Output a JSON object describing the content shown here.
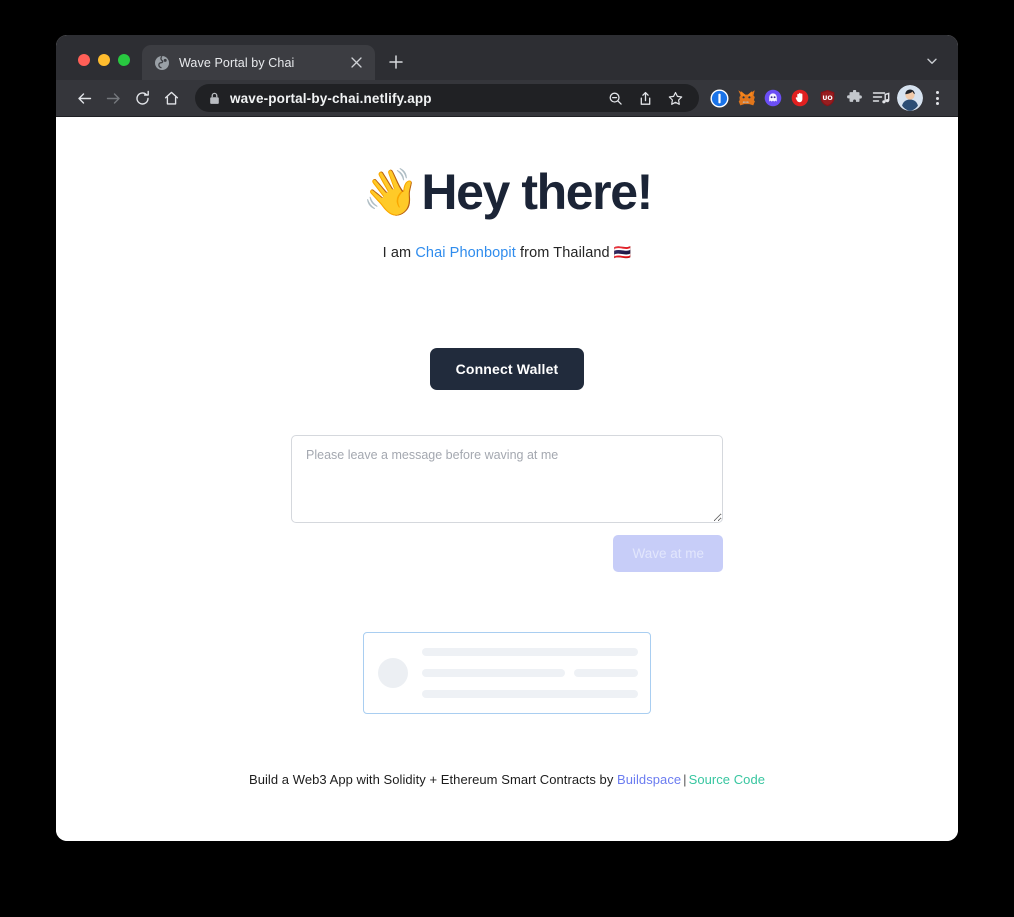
{
  "browser": {
    "tab": {
      "title": "Wave Portal by Chai",
      "favicon_icon": "globe-icon",
      "close_icon": "close-icon"
    },
    "new_tab_icon": "plus-icon",
    "tab_search_icon": "chevron-down-icon",
    "nav": {
      "back_icon": "back-arrow-icon",
      "forward_icon": "forward-arrow-icon",
      "reload_icon": "reload-icon",
      "home_icon": "home-icon"
    },
    "omnibox": {
      "lock_icon": "lock-icon",
      "url": "wave-portal-by-chai.netlify.app",
      "zoom_out_icon": "zoom-out-icon",
      "share_icon": "share-icon",
      "bookmark_icon": "star-icon"
    },
    "extensions": [
      {
        "name": "onepassword-extension-icon",
        "glyph": "1",
        "color": "#1a73e8"
      },
      {
        "name": "metamask-extension-icon",
        "glyph": "🦊",
        "color": "#f6851b"
      },
      {
        "name": "ghost-extension-icon",
        "glyph": "👻",
        "color": "#6b4ef5"
      },
      {
        "name": "adblock-extension-icon",
        "glyph": "✋",
        "color": "#e02020"
      },
      {
        "name": "ublock-origin-extension-icon",
        "glyph": "UO",
        "color": "#8b1116"
      },
      {
        "name": "extensions-puzzle-icon",
        "glyph": "🧩",
        "color": "#9aa0a6"
      },
      {
        "name": "media-playlist-icon",
        "glyph": "♫",
        "color": "#e2e4e8"
      }
    ],
    "avatar_name": "profile-avatar",
    "menu_icon": "three-dot-menu-icon"
  },
  "page": {
    "headline": {
      "emoji": "👋",
      "text": "Hey there!"
    },
    "subtitle": {
      "prefix": "I am ",
      "link": "Chai Phonbopit",
      "suffix": " from Thailand ",
      "flag": "🇹🇭"
    },
    "connect_wallet_label": "Connect Wallet",
    "message_placeholder": "Please leave a message before waving at me",
    "message_value": "",
    "wave_button_label": "Wave at me",
    "skeleton": {
      "avatar_name": "skeleton-avatar",
      "rows": 3
    },
    "footer": {
      "text": "Build a Web3 App with Solidity + Ethereum Smart Contracts by ",
      "buildspace_link": "Buildspace",
      "separator": "|",
      "source_link": "Source Code"
    }
  },
  "colors": {
    "headline": "#1b2436",
    "button_dark": "#212b3c",
    "link_blue": "#2f8ced",
    "wave_button": "#c7cdf8",
    "skeleton_border": "#a9cef1",
    "buildspace": "#6b7cf0",
    "source_code": "#38c6a0"
  }
}
